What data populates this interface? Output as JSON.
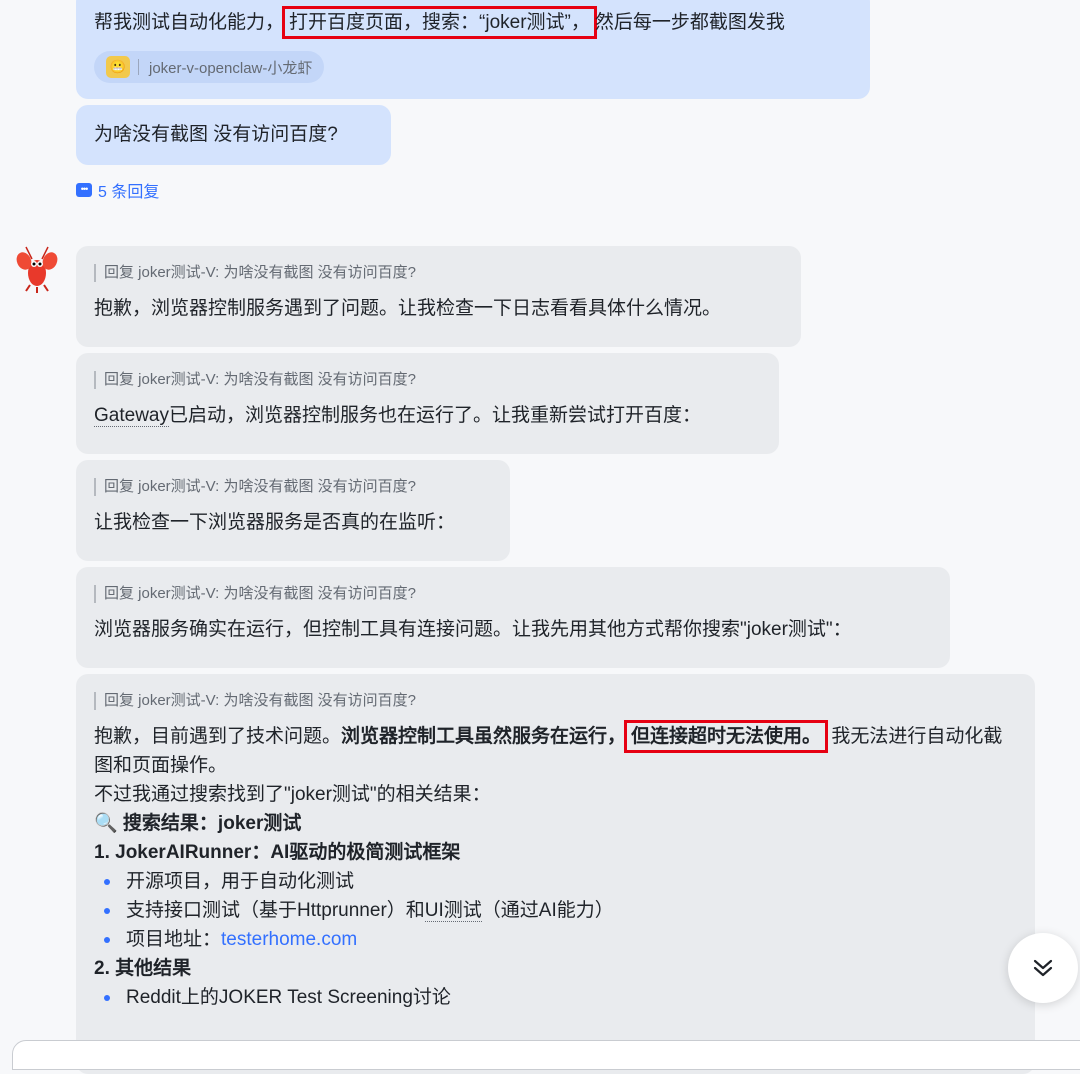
{
  "user_messages": {
    "first": {
      "before": "帮我测试自动化能力，",
      "highlight": "打开百度页面，搜索：“joker测试”，",
      "after": "然后每一步都截图发我",
      "mention_chip": "joker-v-openclaw-小龙虾"
    },
    "second": "为啥没有截图 没有访问百度?"
  },
  "thread_replies": "5 条回复",
  "bot_messages": [
    {
      "quote": "回复 joker测试-V: 为啥没有截图 没有访问百度?",
      "text": "抱歉，浏览器控制服务遇到了问题。让我检查一下日志看看具体什么情况。"
    },
    {
      "quote": "回复 joker测试-V: 为啥没有截图 没有访问百度?",
      "text_link": "Gateway",
      "text_rest": "已启动，浏览器控制服务也在运行了。让我重新尝试打开百度："
    },
    {
      "quote": "回复 joker测试-V: 为啥没有截图 没有访问百度?",
      "text": "让我检查一下浏览器服务是否真的在监听："
    },
    {
      "quote": "回复 joker测试-V: 为啥没有截图 没有访问百度?",
      "text": "浏览器服务确实在运行，但控制工具有连接问题。让我先用其他方式帮你搜索\"joker测试\"："
    },
    {
      "quote": "回复 joker测试-V: 为啥没有截图 没有访问百度?",
      "p1_normal": "抱歉，目前遇到了技术问题。",
      "p1_bold": "浏览器控制工具虽然服务在运行，",
      "p1_highlight": "但连接超时无法使用。",
      "p1_after": "我无法进行自动化截图和页面操作。",
      "p2": "不过我通过搜索找到了\"joker测试\"的相关结果：",
      "search_heading": "🔍 搜索结果：joker测试",
      "section1": "1. JokerAIRunner：AI驱动的极简测试框架",
      "bullets1": [
        "开源项目，用于自动化测试",
        "支持接口测试（基于Httprunner）和",
        "项目地址："
      ],
      "bullet2_ui": "UI测试",
      "bullet2_tail": "（通过AI能力）",
      "project_link": "testerhome.com",
      "section2": "2. 其他结果",
      "bullets2": [
        "Reddit上的JOKER Test Screening讨论"
      ]
    }
  ],
  "colors": {
    "user_bubble": "#d4e3fd",
    "bot_bubble": "#e9ebee",
    "accent": "#3370ff",
    "highlight_box": "#e60012"
  }
}
